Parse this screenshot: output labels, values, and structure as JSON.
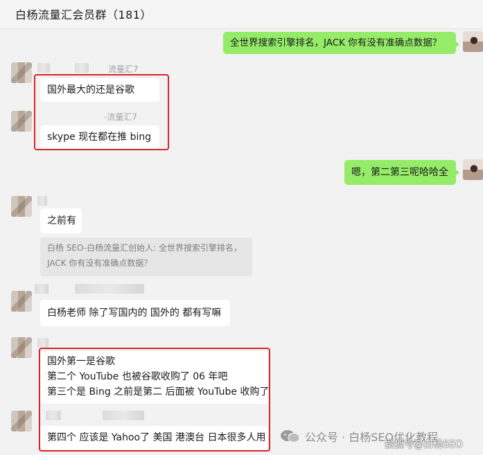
{
  "header": {
    "title": "白杨流量汇会员群（181）"
  },
  "messages": {
    "m1": {
      "text": "全世界搜索引擎排名，JACK 你有没有准确点数据？"
    },
    "m2": {
      "sender": "流量汇7",
      "text": "国外最大的还是谷歌"
    },
    "m3": {
      "sender": "-流量汇7",
      "text": "skype 现在都在推 bing"
    },
    "m4": {
      "text": "嗯，第二第三呢哈哈全"
    },
    "m5": {
      "text": "之前有",
      "quote_line1": "白杨 SEO-白杨流量汇创始人: 全世界搜索引擎排名，",
      "quote_line2": "JACK 你有没有准确点数据？"
    },
    "m6": {
      "text": "白杨老师 除了写国内的 国外的 都有写嘛"
    },
    "m7": {
      "line1": "国外第一是谷歌",
      "line2": "第二个 YouTube 也被谷歌收购了 06 年吧",
      "line3": "第三个是 Bing 之前是第二 后面被 YouTube 收购了"
    },
    "m8": {
      "text": "第四个 应该是 Yahoo了 美国 港澳台 日本很多人用"
    }
  },
  "watermark": {
    "text": "公众号 · 白杨SEO优化教程",
    "sub": "搜狐号@白杨SEO"
  },
  "colors": {
    "self_bubble": "#95ec69",
    "other_bubble": "#ffffff",
    "highlight_box": "#d8232a",
    "background": "#f2f2f2"
  },
  "icons": [
    "wechat-official-account-icon"
  ]
}
